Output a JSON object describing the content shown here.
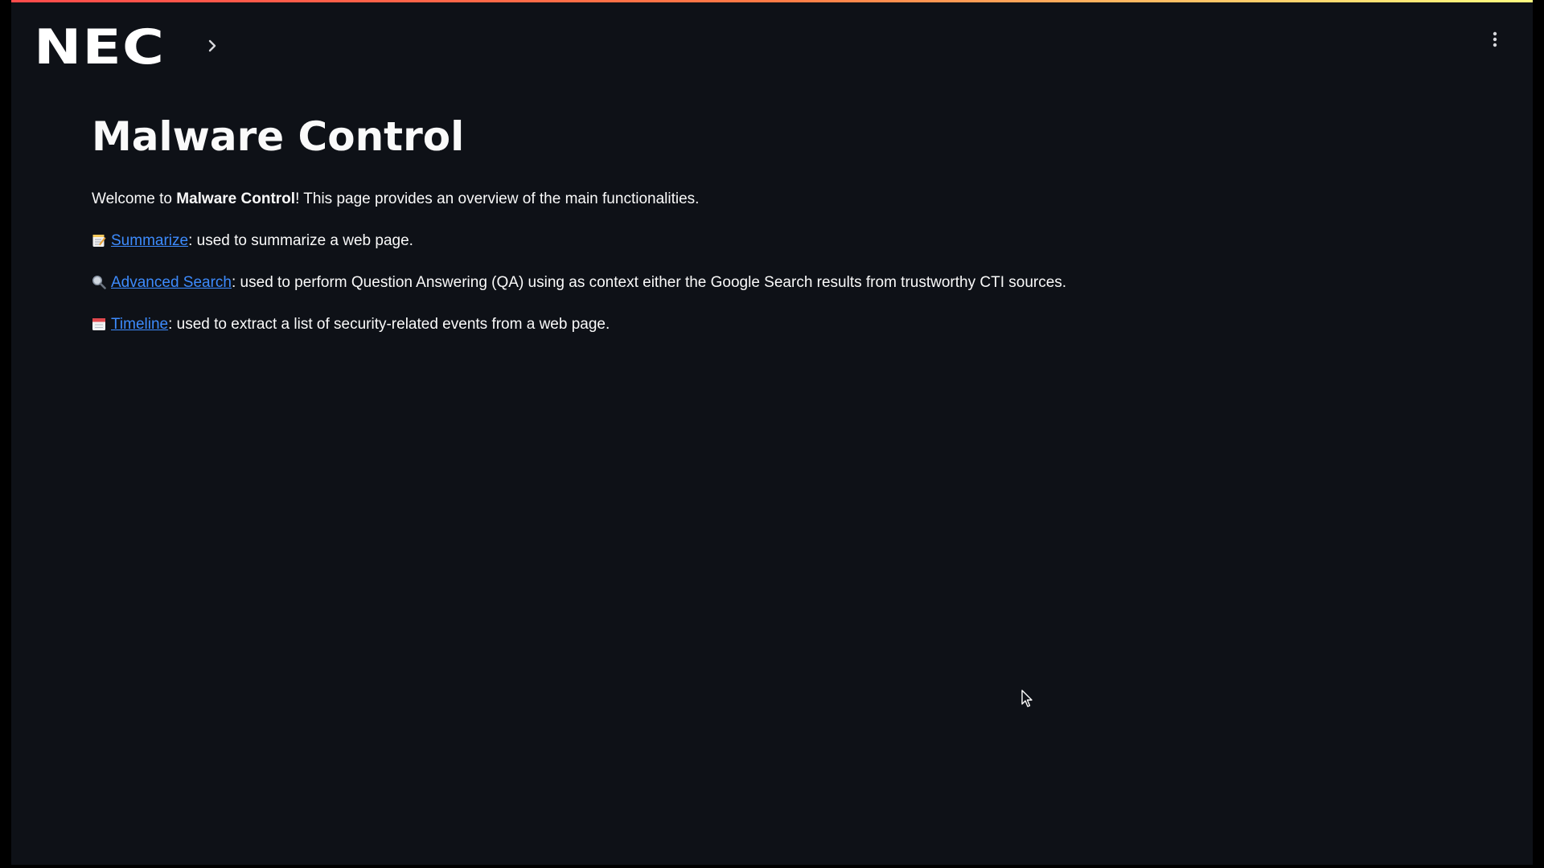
{
  "header": {
    "logo_text": "NEC",
    "sidebar_toggle_icon": "chevron-right-icon",
    "menu_icon": "vertical-ellipsis-icon"
  },
  "main": {
    "title": "Malware Control",
    "intro": {
      "prefix": "Welcome to ",
      "bold": "Malware Control",
      "suffix": "! This page provides an overview of the main functionalities."
    },
    "features": [
      {
        "icon": "memo-icon",
        "link_label": "Summarize",
        "description": ": used to summarize a web page."
      },
      {
        "icon": "magnifying-glass-icon",
        "link_label": "Advanced Search",
        "description": ": used to perform Question Answering (QA) using as context either the Google Search results from trustworthy CTI sources."
      },
      {
        "icon": "calendar-icon",
        "link_label": "Timeline",
        "description": ": used to extract a list of security-related events from a web page."
      }
    ]
  },
  "colors": {
    "background": "#0e1117",
    "text": "#fafafa",
    "link": "#3d8bfd",
    "top_gradient_start": "#ff4b4b",
    "top_gradient_end": "#fffd80"
  }
}
